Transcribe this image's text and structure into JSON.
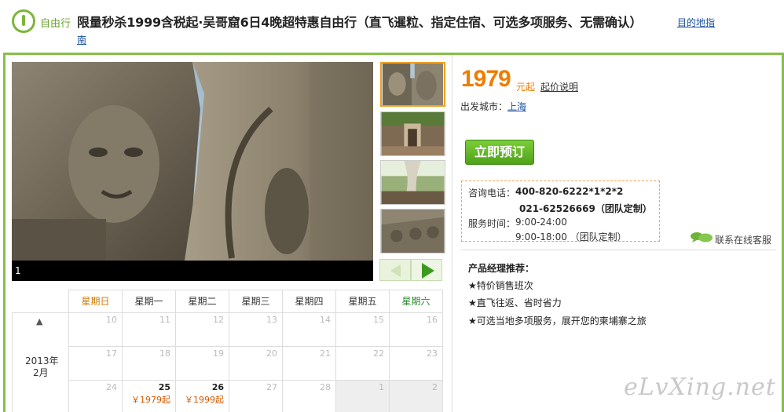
{
  "header": {
    "tag": "自由行",
    "title": "限量秒杀1999含税起·吴哥窟6日4晚超特惠自由行（直飞暹粒、指定住宿、可选多项服务、无需确认）",
    "link_part1": "目的地指",
    "link_part2": "南"
  },
  "gallery": {
    "counter": "1",
    "thumbnails": [
      "temple-faces",
      "temple-doorway",
      "tree-ruins",
      "stone-carving"
    ],
    "selected_index": 0
  },
  "calendar": {
    "weekdays": [
      "星期日",
      "星期一",
      "星期二",
      "星期三",
      "星期四",
      "星期五",
      "星期六"
    ],
    "year": "2013年",
    "month": "2月",
    "up_arrow": "▲",
    "rows": [
      [
        {
          "d": "",
          "p": ""
        },
        {
          "d": "10",
          "p": ""
        },
        {
          "d": "11",
          "p": ""
        },
        {
          "d": "12",
          "p": ""
        },
        {
          "d": "13",
          "p": ""
        },
        {
          "d": "14",
          "p": ""
        },
        {
          "d": "15",
          "p": ""
        },
        {
          "d": "16",
          "p": ""
        }
      ],
      [
        {
          "d": "",
          "p": ""
        },
        {
          "d": "17",
          "p": ""
        },
        {
          "d": "18",
          "p": ""
        },
        {
          "d": "19",
          "p": ""
        },
        {
          "d": "20",
          "p": ""
        },
        {
          "d": "21",
          "p": ""
        },
        {
          "d": "22",
          "p": ""
        },
        {
          "d": "23",
          "p": ""
        }
      ],
      [
        {
          "d": "",
          "p": ""
        },
        {
          "d": "24",
          "p": ""
        },
        {
          "d": "25",
          "p": "￥1979起"
        },
        {
          "d": "26",
          "p": "￥1999起"
        },
        {
          "d": "27",
          "p": ""
        },
        {
          "d": "28",
          "p": ""
        },
        {
          "d": "1",
          "p": ""
        },
        {
          "d": "2",
          "p": ""
        }
      ]
    ]
  },
  "price": {
    "value": "1979",
    "unit": "元起",
    "note": "起价说明"
  },
  "departure": {
    "label": "出发城市：",
    "city": "上海"
  },
  "book_button": "立即预订",
  "contact": {
    "phone_label": "咨询电话：",
    "phone1": "400-820-6222*1*2*2",
    "phone2": "021-62526669（团队定制）",
    "hours_label": "服务时间：",
    "hours1": "9:00-24:00",
    "hours2": "9:00-18:00 （团队定制）"
  },
  "online_service": "联系在线客服",
  "manager": {
    "title": "产品经理推荐：",
    "items": [
      "★特价销售班次",
      "★直飞往返、省时省力",
      "★可选当地多项服务，展开您的柬埔寨之旅"
    ]
  },
  "watermark": "eLvXing.net"
}
